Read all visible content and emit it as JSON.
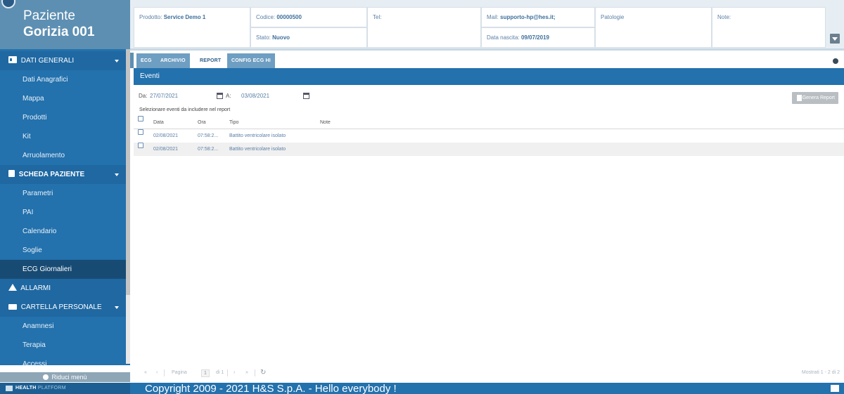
{
  "patient": {
    "line1": "Paziente",
    "line2": "Gorizia 001"
  },
  "header": {
    "prodotto": {
      "label": "Prodotto:",
      "value": "Service Demo 1"
    },
    "codice": {
      "label": "Codice:",
      "value": "00000500"
    },
    "stato": {
      "label": "Stato:",
      "value": "Nuovo"
    },
    "tel": {
      "label": "Tel:",
      "value": ""
    },
    "mail": {
      "label": "Mail:",
      "value": "supporto-hp@hes.it;"
    },
    "nascita": {
      "label": "Data nascita:",
      "value": "09/07/2019"
    },
    "patologie": {
      "label": "Patologie",
      "value": ""
    },
    "note": {
      "label": "Note:",
      "value": ""
    }
  },
  "sidebar": {
    "sections": [
      {
        "label": "DATI GENERALI",
        "icon": "card-icon"
      },
      {
        "label": "SCHEDA PAZIENTE",
        "icon": "file-icon"
      },
      {
        "label": "ALLARMI",
        "icon": "warning-icon"
      },
      {
        "label": "CARTELLA PERSONALE",
        "icon": "folder-icon"
      }
    ],
    "items": [
      "Dati Anagrafici",
      "Mappa",
      "Prodotti",
      "Kit",
      "Arruolamento",
      "Parametri",
      "PAI",
      "Calendario",
      "Soglie",
      "ECG Giornalieri",
      "Anamnesi",
      "Terapia",
      "Accessi"
    ],
    "active_item": "ECG Giornalieri",
    "reduce_label": "Riduci menù"
  },
  "tabs": [
    {
      "label": "ECG",
      "active": false
    },
    {
      "label": "ARCHIVIO",
      "active": false
    },
    {
      "label": "REPORT",
      "active": true
    },
    {
      "label": "CONFIG ECG HI",
      "active": false
    }
  ],
  "panel": {
    "title": "Eventi",
    "from_label": "Da:",
    "from_value": "27/07/2021",
    "to_label": "A:",
    "to_value": "03/08/2021",
    "hint": "Selezionare eventi da includere nel report",
    "generate_label": "Genera Report"
  },
  "table": {
    "headers": {
      "data": "Data",
      "ora": "Ora",
      "tipo": "Tipo",
      "note": "Note"
    },
    "rows": [
      {
        "data": "02/08/2021",
        "ora": "07:58:2...",
        "tipo": "Battito ventricolare isolato",
        "note": ""
      },
      {
        "data": "02/08/2021",
        "ora": "07:58:2...",
        "tipo": "Battito ventricolare isolato",
        "note": ""
      }
    ]
  },
  "pager": {
    "first": "«",
    "prev": "‹",
    "page_label": "Pagina",
    "page_value": "1",
    "of_label": "di 1",
    "next": "›",
    "last": "»",
    "refresh": "↻",
    "summary": "Mostrati 1 - 2 di 2"
  },
  "footer": {
    "brand_bold": "HEALTH",
    "brand_rest": "PLATFORM",
    "copyright": "Copyright 2009 - 2021 H&S S.p.A. - Hello everybody !"
  },
  "colors": {
    "primary": "#2371ad",
    "header_bg": "#e6eef4",
    "active_item": "#184b74"
  }
}
